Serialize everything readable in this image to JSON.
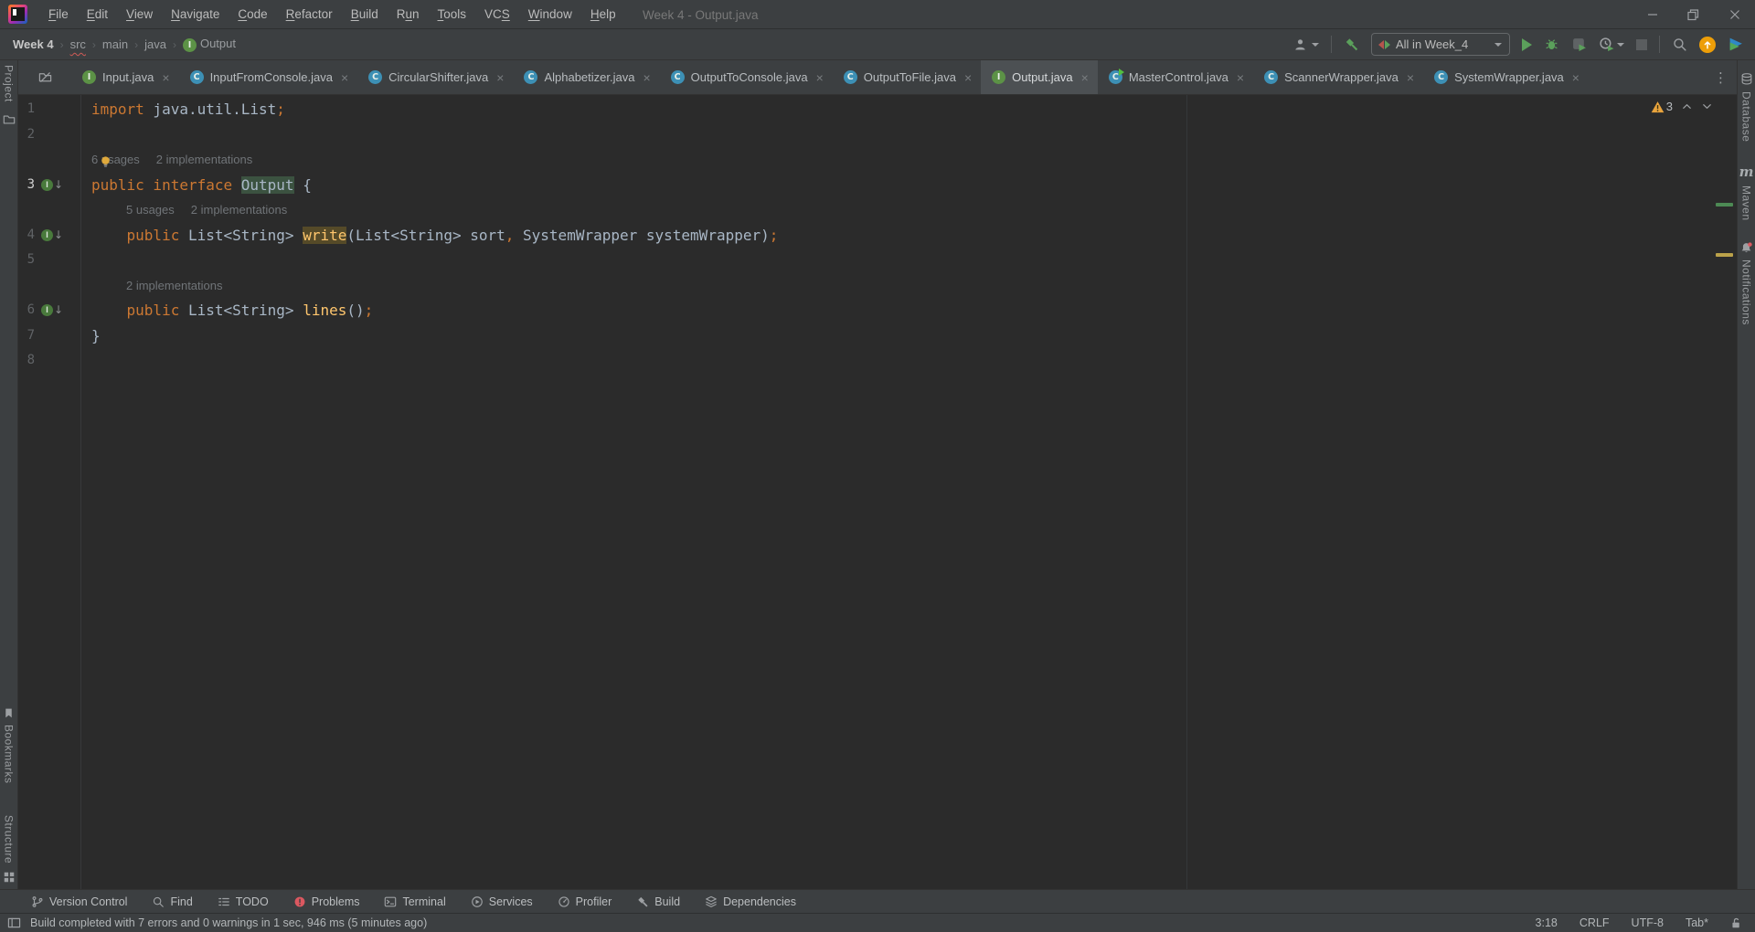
{
  "titlebar": {
    "title": "Week 4 - Output.java",
    "menu": {
      "items": [
        {
          "label": "File",
          "m": 0
        },
        {
          "label": "Edit",
          "m": 0
        },
        {
          "label": "View",
          "m": 0
        },
        {
          "label": "Navigate",
          "m": 0
        },
        {
          "label": "Code",
          "m": 0
        },
        {
          "label": "Refactor",
          "m": 0
        },
        {
          "label": "Build",
          "m": 0
        },
        {
          "label": "Run",
          "m": 1
        },
        {
          "label": "Tools",
          "m": 0
        },
        {
          "label": "VCS",
          "m": 2
        },
        {
          "label": "Window",
          "m": 0
        },
        {
          "label": "Help",
          "m": 0
        }
      ]
    },
    "window_buttons": [
      "minimize",
      "maximize",
      "close"
    ]
  },
  "breadcrumbs": {
    "items": [
      {
        "label": "Week 4",
        "style": "bold"
      },
      {
        "label": "src",
        "style": "error"
      },
      {
        "label": "main"
      },
      {
        "label": "java"
      },
      {
        "label": "Output",
        "icon": "interface-icon"
      }
    ]
  },
  "toolbar": {
    "run_config": "All in Week_4"
  },
  "tabs": [
    {
      "label": "Input.java",
      "kind": "interface",
      "letter": "I"
    },
    {
      "label": "InputFromConsole.java",
      "kind": "class",
      "letter": "C"
    },
    {
      "label": "CircularShifter.java",
      "kind": "class",
      "letter": "C"
    },
    {
      "label": "Alphabetizer.java",
      "kind": "class",
      "letter": "C"
    },
    {
      "label": "OutputToConsole.java",
      "kind": "class",
      "letter": "C"
    },
    {
      "label": "OutputToFile.java",
      "kind": "class",
      "letter": "C"
    },
    {
      "label": "Output.java",
      "kind": "interface",
      "letter": "I",
      "selected": true
    },
    {
      "label": "MasterControl.java",
      "kind": "class",
      "letter": "C",
      "runnable": true
    },
    {
      "label": "ScannerWrapper.java",
      "kind": "class",
      "letter": "C"
    },
    {
      "label": "SystemWrapper.java",
      "kind": "class",
      "letter": "C"
    }
  ],
  "editor": {
    "inspection": {
      "warnings": "3"
    },
    "rows": [
      {
        "type": "code",
        "no": "1",
        "tokens": [
          [
            "k",
            "import"
          ],
          [
            "t",
            " java.util.List"
          ],
          [
            "k",
            ";"
          ]
        ]
      },
      {
        "type": "code",
        "no": "2",
        "tokens": []
      },
      {
        "type": "inlay",
        "indent": 0,
        "bulb": true,
        "parts": [
          "6 usages",
          "2 implementations"
        ]
      },
      {
        "type": "code",
        "no": "3",
        "current": true,
        "marker": true,
        "tokens": [
          [
            "k",
            "public interface"
          ],
          [
            "t",
            " "
          ],
          [
            "hlg",
            "Output"
          ],
          [
            "t",
            " {"
          ]
        ]
      },
      {
        "type": "inlay",
        "indent": 1,
        "parts": [
          "5 usages",
          "2 implementations"
        ]
      },
      {
        "type": "code",
        "no": "4",
        "marker": true,
        "tokens": [
          [
            "t",
            "    "
          ],
          [
            "k",
            "public"
          ],
          [
            "t",
            " List<String> "
          ],
          [
            "hly",
            "write"
          ],
          [
            "t",
            "(List<String> sort"
          ],
          [
            "k",
            ","
          ],
          [
            "t",
            " SystemWrapper systemWrapper)"
          ],
          [
            "k",
            ";"
          ]
        ]
      },
      {
        "type": "code",
        "no": "5",
        "tokens": []
      },
      {
        "type": "inlay",
        "indent": 1,
        "parts": [
          "2 implementations"
        ]
      },
      {
        "type": "code",
        "no": "6",
        "marker": true,
        "tokens": [
          [
            "t",
            "    "
          ],
          [
            "k",
            "public"
          ],
          [
            "t",
            " List<String> "
          ],
          [
            "m",
            "lines"
          ],
          [
            "t",
            "()"
          ],
          [
            "k",
            ";"
          ]
        ]
      },
      {
        "type": "code",
        "no": "7",
        "tokens": [
          [
            "t",
            "}"
          ]
        ]
      },
      {
        "type": "code",
        "no": "8",
        "tokens": []
      }
    ]
  },
  "left_stripe": {
    "project": "Project",
    "bookmarks": "Bookmarks",
    "structure": "Structure"
  },
  "right_stripe": {
    "items": [
      "Database",
      "Maven",
      "Notifications"
    ],
    "maven_logo": "m"
  },
  "bottom_bar": {
    "items": [
      {
        "label": "Version Control",
        "icon": "version-control-icon"
      },
      {
        "label": "Find",
        "icon": "find-icon"
      },
      {
        "label": "TODO",
        "icon": "todo-icon"
      },
      {
        "label": "Problems",
        "icon": "problems-icon"
      },
      {
        "label": "Terminal",
        "icon": "terminal-icon"
      },
      {
        "label": "Services",
        "icon": "services-icon"
      },
      {
        "label": "Profiler",
        "icon": "profiler-icon"
      },
      {
        "label": "Build",
        "icon": "build-icon"
      },
      {
        "label": "Dependencies",
        "icon": "dependencies-icon"
      }
    ]
  },
  "status_bar": {
    "message": "Build completed with 7 errors and 0 warnings in 1 sec, 946 ms (5 minutes ago)",
    "position": "3:18",
    "line_separator": "CRLF",
    "encoding": "UTF-8",
    "indent": "Tab*"
  },
  "colors": {
    "panel_bg": "#3c3f41",
    "editor_bg": "#2b2b2b",
    "keyword_orange": "#cc7832",
    "method_yellow": "#ffc66d",
    "editor_fg": "#a9b7c6",
    "interface_icon_green": "#5c9246",
    "class_icon_blue": "#3d90b5",
    "run_green": "#5ba05b",
    "warning_yellow": "#e8a33d",
    "error_red": "#db5860",
    "update_orange": "#ed9e08"
  }
}
